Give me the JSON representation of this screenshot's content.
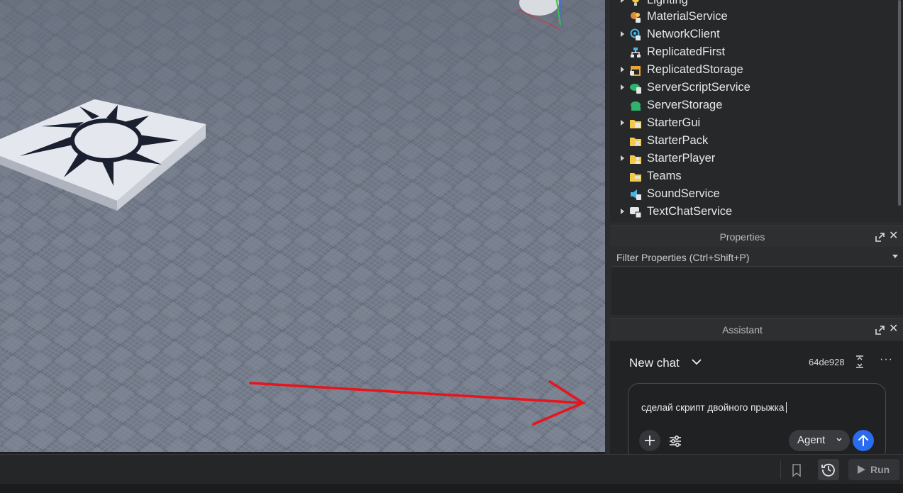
{
  "explorer": {
    "items": [
      {
        "label": "Lighting",
        "expandable": true,
        "icon": "lighting-icon"
      },
      {
        "label": "MaterialService",
        "expandable": false,
        "icon": "material-service-icon"
      },
      {
        "label": "NetworkClient",
        "expandable": true,
        "icon": "network-client-icon"
      },
      {
        "label": "ReplicatedFirst",
        "expandable": false,
        "icon": "replicated-first-icon"
      },
      {
        "label": "ReplicatedStorage",
        "expandable": true,
        "icon": "replicated-storage-icon"
      },
      {
        "label": "ServerScriptService",
        "expandable": true,
        "icon": "server-script-service-icon"
      },
      {
        "label": "ServerStorage",
        "expandable": false,
        "icon": "server-storage-icon"
      },
      {
        "label": "StarterGui",
        "expandable": true,
        "icon": "starter-gui-icon"
      },
      {
        "label": "StarterPack",
        "expandable": false,
        "icon": "starter-pack-icon"
      },
      {
        "label": "StarterPlayer",
        "expandable": true,
        "icon": "starter-player-icon"
      },
      {
        "label": "Teams",
        "expandable": false,
        "icon": "teams-icon"
      },
      {
        "label": "SoundService",
        "expandable": false,
        "icon": "sound-service-icon"
      },
      {
        "label": "TextChatService",
        "expandable": true,
        "icon": "text-chat-service-icon"
      }
    ]
  },
  "properties": {
    "title": "Properties",
    "filter_placeholder": "Filter Properties (Ctrl+Shift+P)"
  },
  "assistant": {
    "title": "Assistant",
    "chat_title": "New chat",
    "commit": "64de928",
    "more": "···",
    "message": "сделай скрипт двойного прыжка",
    "mode": "Agent"
  },
  "toolbar": {
    "run_label": "Run"
  },
  "colors": {
    "accent": "#2a6cf0",
    "annotation_arrow": "#e8141b",
    "panel_bg": "#272829",
    "baseplate": "#6f7684"
  }
}
